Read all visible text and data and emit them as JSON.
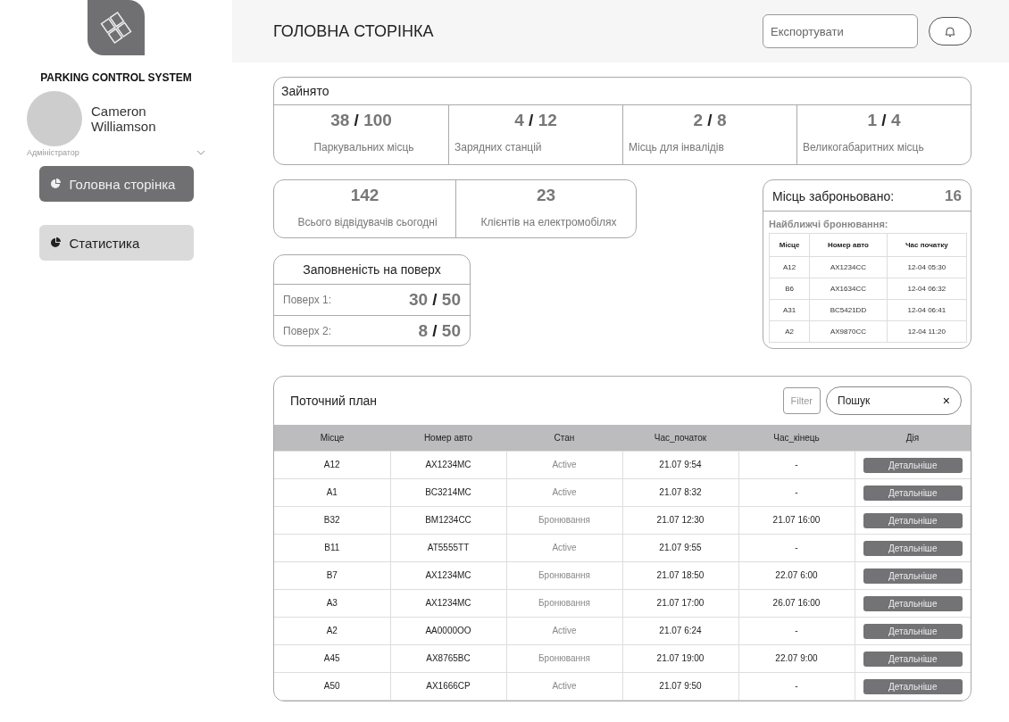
{
  "sidebar": {
    "app_name": "PARKING CONTROL SYSTEM",
    "user": {
      "name": "Cameron Williamson",
      "role": "Адміністратор"
    },
    "nav": [
      {
        "label": "Головна сторінка",
        "selected": true
      },
      {
        "label": "Статистика",
        "selected": false
      }
    ]
  },
  "header": {
    "title": "ГОЛОВНА СТОРІНКА",
    "export_placeholder": "Експортувати"
  },
  "occupied": {
    "title": "Зайнято",
    "stats": [
      {
        "used": "38",
        "sep": "/",
        "total": "100",
        "label": "Паркувальних місць"
      },
      {
        "used": "4",
        "sep": "/",
        "total": "12",
        "label": "Зарядних станцій"
      },
      {
        "used": "2",
        "sep": "/",
        "total": "8",
        "label": "Місць для інвалідів"
      },
      {
        "used": "1",
        "sep": "/",
        "total": "4",
        "label": "Великогабаритних місць"
      }
    ]
  },
  "visitors": [
    {
      "value": "142",
      "label": "Всього відвідувачів сьогодні"
    },
    {
      "value": "23",
      "label": "Клієнтів на електромобілях"
    }
  ],
  "floors": {
    "title": "Заповненість на поверх",
    "rows": [
      {
        "label": "Поверх 1:",
        "used": "30",
        "sep": "/",
        "total": "50"
      },
      {
        "label": "Поверх 2:",
        "used": "8",
        "sep": "/",
        "total": "50"
      }
    ]
  },
  "bookings": {
    "title": "Місць заброньовано:",
    "count": "16",
    "subtitle": "Найближчі бронювання:",
    "columns": [
      "Місце",
      "Номер авто",
      "Час початку"
    ],
    "rows": [
      [
        "A12",
        "AX1234CC",
        "12-04 05:30"
      ],
      [
        "B6",
        "AX1634CC",
        "12-04 06:32"
      ],
      [
        "A31",
        "BC5421DD",
        "12-04 06:41"
      ],
      [
        "A2",
        "AX9870CC",
        "12-04 11:20"
      ]
    ]
  },
  "plan": {
    "title": "Поточний план",
    "filter": "Filter",
    "search": "Пошук",
    "clear": "×",
    "columns": [
      "Місце",
      "Номер авто",
      "Стан",
      "Час_початок",
      "Час_кінець",
      "Дія"
    ],
    "rows": [
      {
        "cells": [
          "A12",
          "AX1234MC",
          "Active",
          "21.07 9:54",
          "-"
        ],
        "action": "Детальніше"
      },
      {
        "cells": [
          "A1",
          "BC3214MC",
          "Active",
          "21.07 8:32",
          "-"
        ],
        "action": "Детальніше"
      },
      {
        "cells": [
          "B32",
          "BM1234CC",
          "Бронювання",
          "21.07 12:30",
          "21.07 16:00"
        ],
        "action": "Детальніше"
      },
      {
        "cells": [
          "B11",
          "AT5555TT",
          "Active",
          "21.07 9:55",
          "-"
        ],
        "action": "Детальніше"
      },
      {
        "cells": [
          "B7",
          "AX1234MC",
          "Бронювання",
          "21.07 18:50",
          "22.07 6:00"
        ],
        "action": "Детальніше"
      },
      {
        "cells": [
          "A3",
          "AX1234MC",
          "Бронювання",
          "21.07 17:00",
          "26.07 16:00"
        ],
        "action": "Детальніше"
      },
      {
        "cells": [
          "A2",
          "AA0000OO",
          "Active",
          "21.07 6:24",
          "-"
        ],
        "action": "Детальніше"
      },
      {
        "cells": [
          "A45",
          "AX8765BC",
          "Бронювання",
          "21.07 19:00",
          "22.07 9:00"
        ],
        "action": "Детальніше"
      },
      {
        "cells": [
          "A50",
          "AX1666CP",
          "Active",
          "21.07 9:50",
          "-"
        ],
        "action": "Детальніше"
      }
    ]
  }
}
